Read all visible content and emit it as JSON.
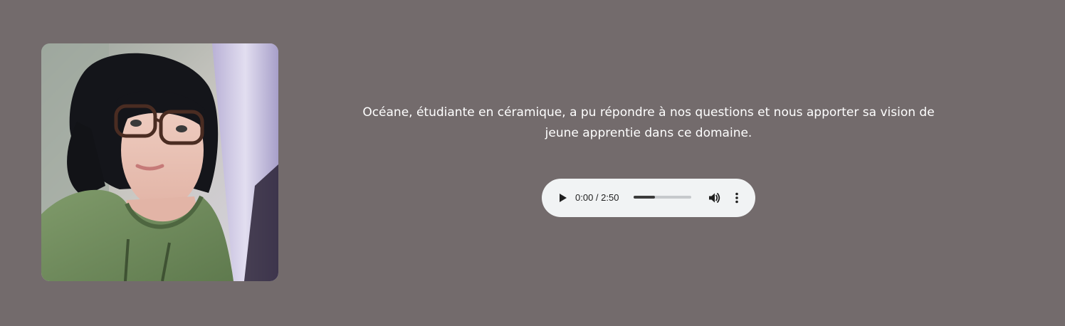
{
  "description": {
    "line1": "Océane, étudiante en céramique, a pu répondre à nos questions et nous apporter sa vision de",
    "line2": "jeune apprentie dans ce domaine."
  },
  "audio_player": {
    "time_display": "0:00 / 2:50",
    "buffered_fraction": 0.37,
    "play_icon": "play-icon",
    "volume_icon": "volume-icon",
    "menu_icon": "more-vert-icon"
  },
  "colors": {
    "background": "#736b6c",
    "player_background": "#f1f3f4",
    "text": "#ffffff"
  }
}
